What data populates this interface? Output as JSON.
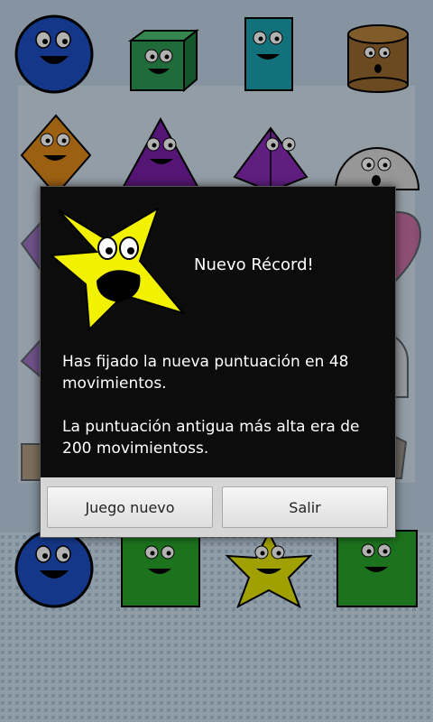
{
  "dialog": {
    "title": "Nuevo Récord!",
    "message_new_score": "Has fijado la nueva puntuación en 48 movimientos.",
    "message_old_score": "La puntuación antigua más alta era de 200 movimientoss.",
    "buttons": {
      "new_game": "Juego nuevo",
      "exit": "Salir"
    },
    "icon": "star-character-icon"
  },
  "board": {
    "pieces": [
      {
        "shape": "circle",
        "color": "#1d4fc4"
      },
      {
        "shape": "cube",
        "color": "#2e9a54"
      },
      {
        "shape": "rectangle",
        "color": "#1aa3b0"
      },
      {
        "shape": "cylinder",
        "color": "#9a6a30"
      },
      {
        "shape": "diamond",
        "color": "#e08a1a"
      },
      {
        "shape": "triangle",
        "color": "#7a1fa6"
      },
      {
        "shape": "pyramid",
        "color": "#7a1fa6"
      },
      {
        "shape": "half-circle",
        "color": "#cccccc"
      },
      {
        "shape": "circle",
        "color": "#1d4fc4"
      },
      {
        "shape": "square",
        "color": "#2aa52a"
      },
      {
        "shape": "star",
        "color": "#e6e600"
      },
      {
        "shape": "square",
        "color": "#2aa52a"
      }
    ]
  }
}
